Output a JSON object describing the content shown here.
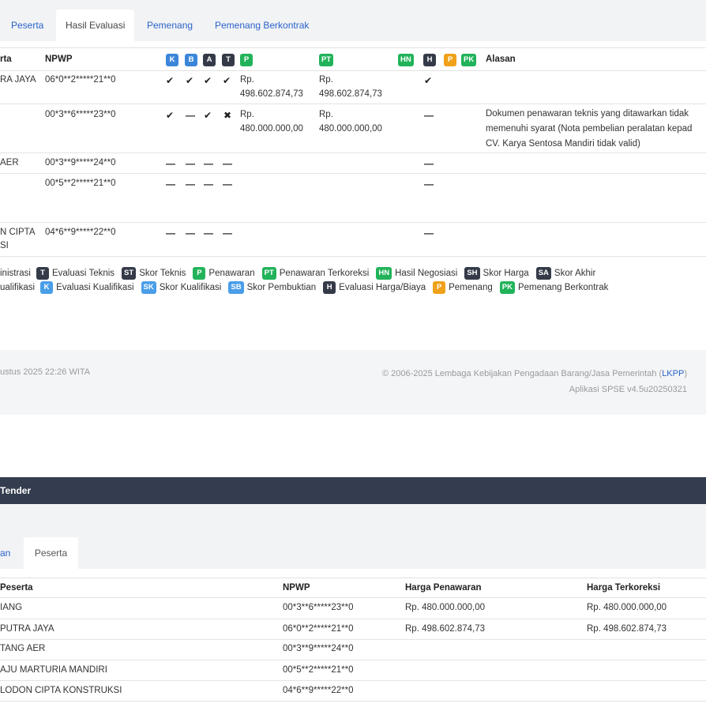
{
  "tabs": [
    "Peserta",
    "Hasil Evaluasi",
    "Pemenang",
    "Pemenang Berkontrak"
  ],
  "table": {
    "headers": {
      "peserta": "rta",
      "npwp": "NPWP",
      "alasan": "Alasan"
    },
    "badges": [
      "K",
      "B",
      "A",
      "T",
      "P",
      "PT",
      "HN",
      "H",
      "P",
      "PK"
    ],
    "rows": [
      {
        "name": "RA JAYA",
        "npwp": "06*0**2*****21**0",
        "k": "✔",
        "b": "✔",
        "a": "✔",
        "t": "✔",
        "p": [
          "Rp.",
          "498.602.874,73"
        ],
        "pt": [
          "Rp.",
          "498.602.874,73"
        ],
        "h": "✔",
        "reason": []
      },
      {
        "name": "",
        "npwp": "00*3**6*****23**0",
        "k": "✔",
        "b": "—",
        "a": "✔",
        "t": "✖",
        "p": [
          "Rp.",
          "480.000.000,00"
        ],
        "pt": [
          "Rp.",
          "480.000.000,00"
        ],
        "h": "—",
        "reason": [
          "Dokumen penawaran teknis yang ditawarkan tidak",
          "memenuhi syarat (Nota pembelian peralatan kepad",
          "CV. Karya Sentosa Mandiri tidak valid)"
        ]
      },
      {
        "name": "AER",
        "npwp": "00*3**9*****24**0",
        "k": "—",
        "b": "—",
        "a": "—",
        "t": "—",
        "h": "—"
      },
      {
        "name": "",
        "npwp": "00*5**2*****21**0",
        "k": "—",
        "b": "—",
        "a": "—",
        "t": "—",
        "h": "—"
      },
      {
        "name": "N CIPTA",
        "name2": "SI",
        "npwp": "04*6**9*****22**0",
        "k": "—",
        "b": "—",
        "a": "—",
        "t": "—",
        "h": "—"
      }
    ]
  },
  "legend": {
    "row1": [
      {
        "badge": "",
        "label": "inistrasi"
      },
      {
        "badge": "T",
        "label": "Evaluasi Teknis"
      },
      {
        "badge": "ST",
        "label": "Skor Teknis"
      },
      {
        "badge": "P",
        "label": "Penawaran"
      },
      {
        "badge": "PT",
        "label": "Penawaran Terkoreksi"
      },
      {
        "badge": "HN",
        "label": "Hasil Negosiasi"
      },
      {
        "badge": "SH",
        "label": "Skor Harga"
      },
      {
        "badge": "SA",
        "label": "Skor Akhir"
      }
    ],
    "row2": [
      {
        "badge": "",
        "label": "ualifikasi"
      },
      {
        "badge": "K",
        "label": "Evaluasi Kualifikasi"
      },
      {
        "badge": "SK",
        "label": "Skor Kualifikasi"
      },
      {
        "badge": "SB",
        "label": "Skor Pembuktian"
      },
      {
        "badge": "H",
        "label": "Evaluasi Harga/Biaya"
      },
      {
        "badge": "P",
        "label": "Pemenang"
      },
      {
        "badge": "PK",
        "label": "Pemenang Berkontrak"
      }
    ]
  },
  "footer": {
    "date": "ustus 2025 22:26 WITA",
    "copyright_pre": "© 2006-2025 Lembaga Kebijakan Pengadaan Barang/Jasa Pemerintah (",
    "copyright_link": "LKPP",
    "copyright_post": ")",
    "app": "Aplikasi SPSE v4.5u20250321"
  },
  "page2": {
    "nav_title": "Tender",
    "tabs": [
      "an",
      "Peserta"
    ],
    "headers": [
      "Peserta",
      "NPWP",
      "Harga Penawaran",
      "Harga Terkoreksi"
    ],
    "rows": [
      {
        "name": "IANG",
        "npwp": "00*3**6*****23**0",
        "harga": "Rp. 480.000.000,00",
        "terkoreksi": "Rp. 480.000.000,00"
      },
      {
        "name": "PUTRA JAYA",
        "npwp": "06*0**2*****21**0",
        "harga": "Rp. 498.602.874,73",
        "terkoreksi": "Rp. 498.602.874,73"
      },
      {
        "name": "TANG AER",
        "npwp": "00*3**9*****24**0",
        "harga": "",
        "terkoreksi": ""
      },
      {
        "name": "AJU MARTURIA MANDIRI",
        "npwp": "00*5**2*****21**0",
        "harga": "",
        "terkoreksi": ""
      },
      {
        "name": "LODON CIPTA KONSTRUKSI",
        "npwp": "04*6**9*****22**0",
        "harga": "",
        "terkoreksi": ""
      }
    ]
  },
  "colors": {
    "link": "#2a63c9",
    "nav": "#343d4f",
    "green": "#22b35a",
    "blue": "#3b86d9",
    "dark": "#343a48",
    "orange": "#f0a11a"
  }
}
